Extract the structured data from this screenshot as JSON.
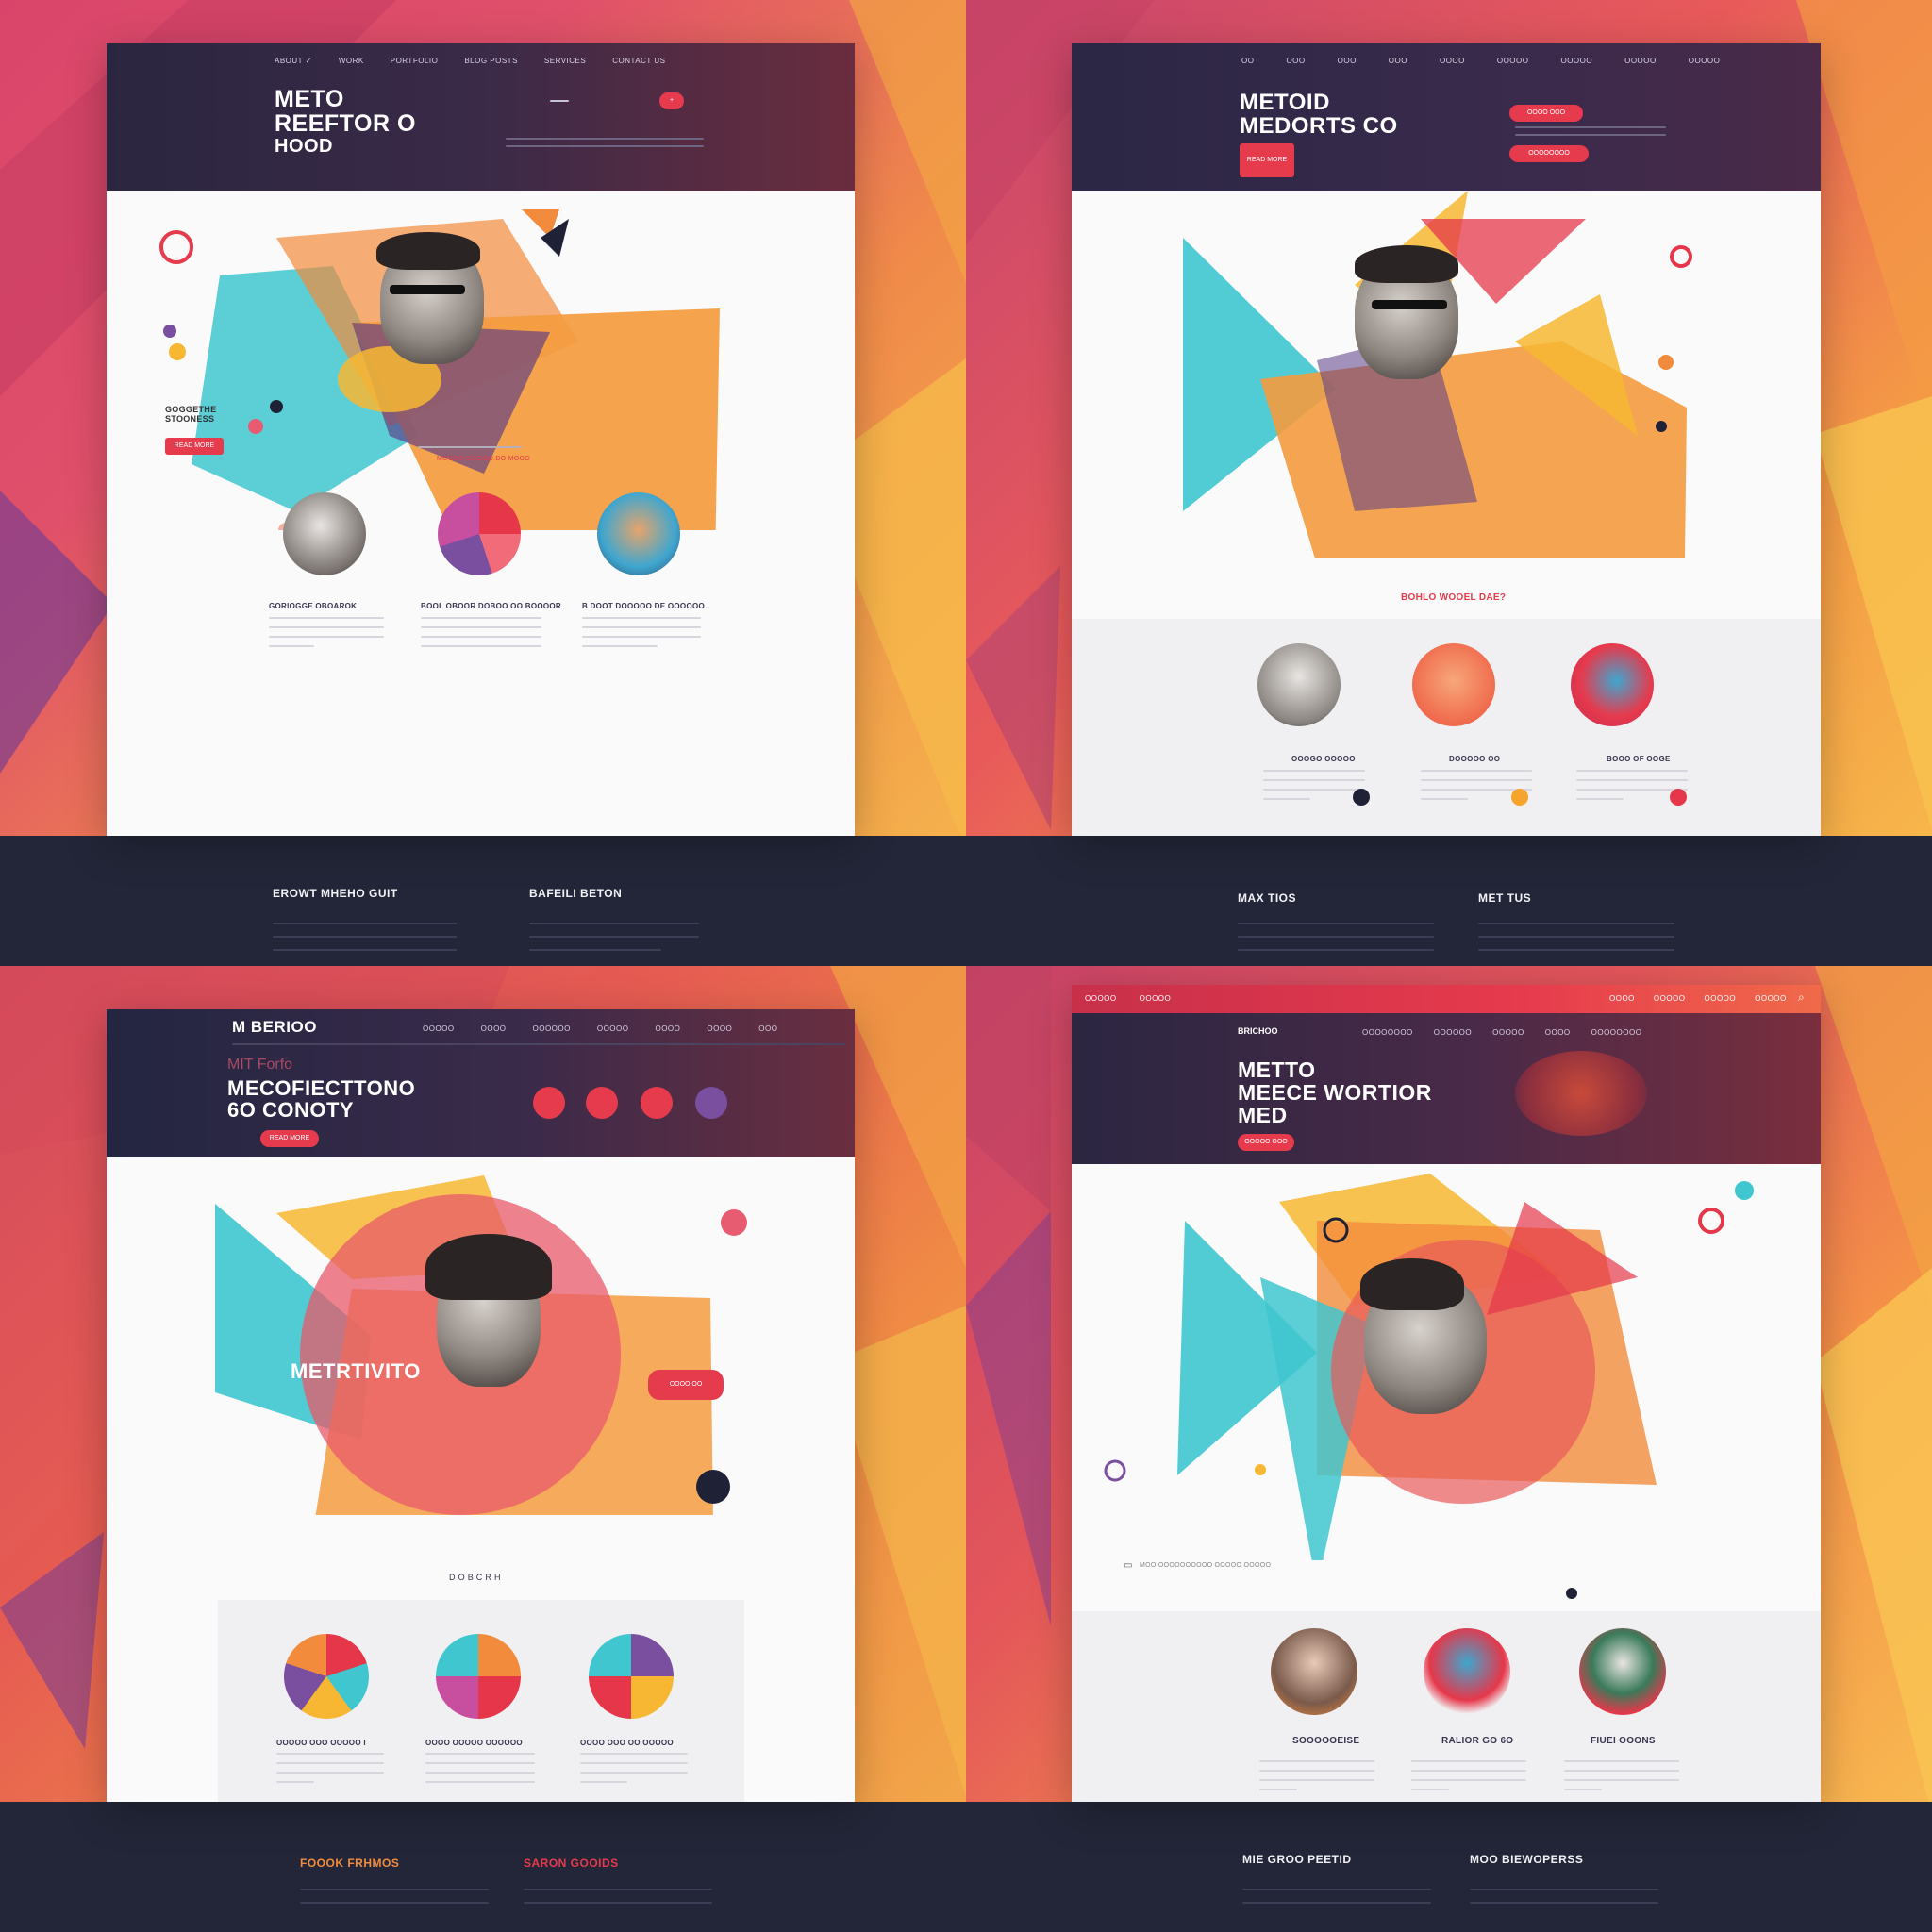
{
  "colors": {
    "accent": "#e63a4d",
    "dark": "#232638",
    "orange": "#f28c3c",
    "teal": "#3fc6cf",
    "yellow": "#f7b733",
    "purple": "#7b4fa0"
  },
  "panel1": {
    "nav": [
      "ABOUT ✓",
      "WORK",
      "PORTFOLIO",
      "BLOG POSTS",
      "SERVICES",
      "CONTACT US"
    ],
    "title": [
      "METO",
      "REEFTOR O",
      "HOOD"
    ],
    "header_button": "+",
    "side_heading": [
      "GOGGETHE",
      "STOONESS"
    ],
    "side_button": "READ MORE",
    "center_caption": "MOGOO GOOOO  DO  MOOO",
    "cards": [
      "GORIOGGE OBOAROK",
      "BOOL OBOOR DOBOO OO BOOOOR",
      "B DOOT DOOOOO DE OOOOOO"
    ],
    "footer": [
      "EROWT MHEHO GUIT",
      "BAFEILI BETON"
    ]
  },
  "panel2": {
    "nav": [
      "OO",
      "OOO",
      "OOO",
      "OOO",
      "OOOO",
      "OOOOO",
      "OOOOO",
      "OOOOO",
      "OOOOO"
    ],
    "title": [
      "METOID",
      "MEDORTS CO"
    ],
    "header_button": "READ MORE",
    "pill_a": "OOOO OOO",
    "pill_b": "OOOOOOOO",
    "tagline": "BOHLO WOOEL DAE?",
    "cards": [
      "OOOGO OOOOO",
      "DOOOOO OO",
      "BOOO OF OOGE"
    ],
    "footer": [
      "MAX TIOS",
      "MET TUS"
    ]
  },
  "panel3": {
    "brand": "M BERIOO",
    "nav": [
      "OOOOO",
      "OOOO",
      "OOOOOO",
      "OOOOO",
      "OOOO",
      "OOOO",
      "OOO"
    ],
    "kicker": "MIT Forfo",
    "title": [
      "MECOFIECTTONO",
      "6O CONOTY"
    ],
    "header_button": "READ MORE",
    "hero_text": "METRTIVITO",
    "hero_button": "OOOO OO",
    "section_label": "D O B C R H",
    "cards": [
      "OOOOO OOO OOOOO I",
      "OOOO OOOOO OOOOOO",
      "OOOO OOO OO OOOOO"
    ],
    "footer": [
      "FOOOK FRHMOS",
      "SARON GOOIDS"
    ]
  },
  "panel4": {
    "topnav": [
      "OOOOO",
      "OOOOO",
      "OOOO",
      "OOOOO",
      "OOOOO",
      "OOOOO"
    ],
    "brand": "BRICHOO",
    "nav": [
      "OOOOOOOO",
      "OOOOOO",
      "OOOOO",
      "OOOO",
      "OOOOOOOO"
    ],
    "title": [
      "METTO",
      "MEECE WORTIOR",
      "MED"
    ],
    "header_button": "OOOOO OOO",
    "caption": "MOO OOOOOOOOOO OOOOO OOOOO",
    "cards": [
      "SOOOOOEISE",
      "RALIOR GO 6O",
      "FIUEI OOONS"
    ],
    "footer": [
      "MIE GROO PEETID",
      "MOO BIEWOPERSS"
    ]
  }
}
